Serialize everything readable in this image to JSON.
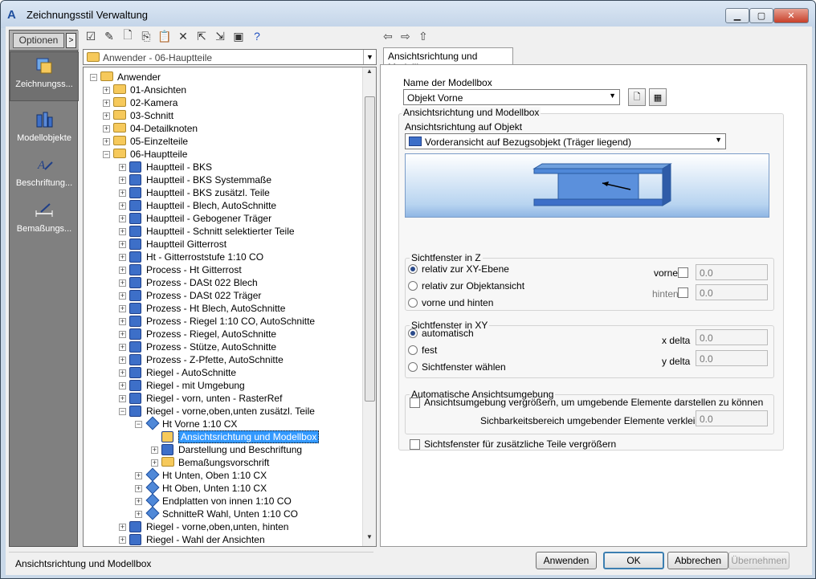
{
  "window": {
    "title": "Zeichnungsstil Verwaltung",
    "app_icon": "autocad-a-icon"
  },
  "leftpanel": {
    "options_label": "Optionen",
    "categories": [
      {
        "label": "Zeichnungss...",
        "icon": "drawing-style-icon",
        "selected": true
      },
      {
        "label": "Modellobjekte",
        "icon": "model-objects-icon",
        "selected": false
      },
      {
        "label": "Beschriftung...",
        "icon": "annotation-icon",
        "selected": false
      },
      {
        "label": "Bemaßungs...",
        "icon": "dimension-icon",
        "selected": false
      }
    ]
  },
  "combo": {
    "value": "Anwender - 06-Hauptteile"
  },
  "tree": {
    "items": [
      {
        "label": "Anwender",
        "level": 0,
        "exp": "−",
        "icon": "folder"
      },
      {
        "label": "01-Ansichten",
        "level": 1,
        "exp": "+",
        "icon": "folder"
      },
      {
        "label": "02-Kamera",
        "level": 1,
        "exp": "+",
        "icon": "folder"
      },
      {
        "label": "03-Schnitt",
        "level": 1,
        "exp": "+",
        "icon": "folder"
      },
      {
        "label": "04-Detailknoten",
        "level": 1,
        "exp": "+",
        "icon": "folder"
      },
      {
        "label": "05-Einzelteile",
        "level": 1,
        "exp": "+",
        "icon": "folder"
      },
      {
        "label": "06-Hauptteile",
        "level": 1,
        "exp": "−",
        "icon": "folder"
      },
      {
        "label": "Hauptteil - BKS",
        "level": 2,
        "exp": "+",
        "icon": "style"
      },
      {
        "label": "Hauptteil - BKS Systemmaße",
        "level": 2,
        "exp": "+",
        "icon": "style"
      },
      {
        "label": "Hauptteil - BKS zusätzl. Teile",
        "level": 2,
        "exp": "+",
        "icon": "style"
      },
      {
        "label": "Hauptteil - Blech, AutoSchnitte",
        "level": 2,
        "exp": "+",
        "icon": "style"
      },
      {
        "label": "Hauptteil - Gebogener Träger",
        "level": 2,
        "exp": "+",
        "icon": "style"
      },
      {
        "label": "Hauptteil - Schnitt selektierter Teile",
        "level": 2,
        "exp": "+",
        "icon": "style"
      },
      {
        "label": "Hauptteil Gitterrost",
        "level": 2,
        "exp": "+",
        "icon": "style"
      },
      {
        "label": "Ht - Gitterroststufe 1:10 CO",
        "level": 2,
        "exp": "+",
        "icon": "style"
      },
      {
        "label": "Process - Ht Gitterrost",
        "level": 2,
        "exp": "+",
        "icon": "style"
      },
      {
        "label": "Prozess - DASt 022 Blech",
        "level": 2,
        "exp": "+",
        "icon": "style"
      },
      {
        "label": "Prozess - DASt 022 Träger",
        "level": 2,
        "exp": "+",
        "icon": "style"
      },
      {
        "label": "Prozess - Ht Blech, AutoSchnitte",
        "level": 2,
        "exp": "+",
        "icon": "style"
      },
      {
        "label": "Prozess - Riegel 1:10 CO, AutoSchnitte",
        "level": 2,
        "exp": "+",
        "icon": "style"
      },
      {
        "label": "Prozess - Riegel, AutoSchnitte",
        "level": 2,
        "exp": "+",
        "icon": "style"
      },
      {
        "label": "Prozess - Stütze, AutoSchnitte",
        "level": 2,
        "exp": "+",
        "icon": "style"
      },
      {
        "label": "Prozess - Z-Pfette, AutoSchnitte",
        "level": 2,
        "exp": "+",
        "icon": "style"
      },
      {
        "label": "Riegel - AutoSchnitte",
        "level": 2,
        "exp": "+",
        "icon": "style"
      },
      {
        "label": "Riegel - mit Umgebung",
        "level": 2,
        "exp": "+",
        "icon": "style"
      },
      {
        "label": "Riegel - vorn, unten - RasterRef",
        "level": 2,
        "exp": "+",
        "icon": "style"
      },
      {
        "label": "Riegel - vorne,oben,unten zusätzl. Teile",
        "level": 2,
        "exp": "−",
        "icon": "style"
      },
      {
        "label": "Ht Vorne 1:10 CX",
        "level": 3,
        "exp": "−",
        "icon": "diamond"
      },
      {
        "label": "Ansichtsrichtung und Modellbox",
        "level": 4,
        "exp": "",
        "icon": "view",
        "selected": true
      },
      {
        "label": "Darstellung und Beschriftung",
        "level": 4,
        "exp": "+",
        "icon": "style"
      },
      {
        "label": "Bemaßungsvorschrift",
        "level": 4,
        "exp": "+",
        "icon": "folder"
      },
      {
        "label": "Ht Unten, Oben 1:10 CX",
        "level": 3,
        "exp": "+",
        "icon": "diamond"
      },
      {
        "label": "Ht Oben, Unten 1:10 CX",
        "level": 3,
        "exp": "+",
        "icon": "diamond"
      },
      {
        "label": "Endplatten von innen 1:10 CO",
        "level": 3,
        "exp": "+",
        "icon": "diamond"
      },
      {
        "label": "SchnitteR Wahl, Unten 1:10 CO",
        "level": 3,
        "exp": "+",
        "icon": "diamond"
      },
      {
        "label": "Riegel - vorne,oben,unten, hinten",
        "level": 2,
        "exp": "+",
        "icon": "style"
      },
      {
        "label": "Riegel - Wahl der Ansichten",
        "level": 2,
        "exp": "+",
        "icon": "style"
      }
    ]
  },
  "right": {
    "tab_label": "Ansichtsrichtung und Modellbox",
    "modelbox_name_label": "Name der Modellbox",
    "modelbox_value": "Objekt Vorne",
    "group_main_title": "Ansichtsrichtung und Modellbox",
    "direction_label": "Ansichtsrichtung auf Objekt",
    "direction_value": "Vorderansicht auf Bezugsobjekt (Träger liegend)",
    "z_group": {
      "title": "Sichtfenster in Z",
      "options": [
        "relativ zur XY-Ebene",
        "relativ zur Objektansicht",
        "vorne und hinten"
      ],
      "selected": 0,
      "front_label": "vorne",
      "back_label": "hinten",
      "front_value": "0.0",
      "back_value": "0.0"
    },
    "xy_group": {
      "title": "Sichtfenster in XY",
      "options": [
        "automatisch",
        "fest",
        "Sichtfenster wählen"
      ],
      "selected": 0,
      "xdelta_label": "x delta",
      "ydelta_label": "y delta",
      "xdelta_value": "0.0",
      "ydelta_value": "0.0"
    },
    "auto_group": {
      "title": "Automatische Ansichtsumgebung",
      "checkbox_label": "Ansichtsumgebung vergrößern, um umgebende Elemente darstellen zu können",
      "reduce_label": "Sichbarkeitsbereich umgebender Elemente verkleinern",
      "reduce_value": "0.0"
    },
    "enlarge_checkbox_label": "Sichtsfenster für zusätzliche Teile vergrößern"
  },
  "status_text": "Ansichtsrichtung und Modellbox",
  "buttons": {
    "apply": "Anwenden",
    "ok": "OK",
    "cancel": "Abbrechen",
    "adopt": "Übernehmen"
  }
}
